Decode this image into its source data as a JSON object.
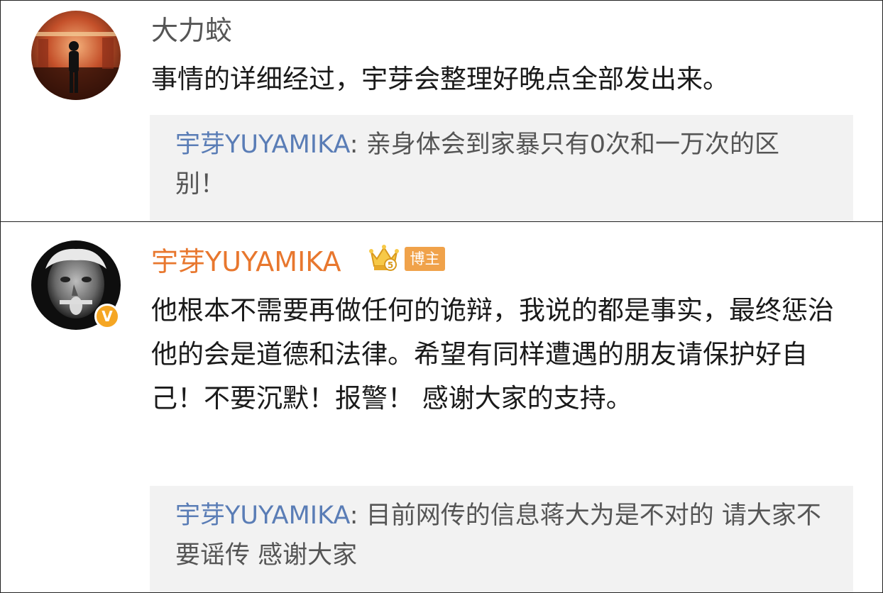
{
  "comments": [
    {
      "username": "大力蛟",
      "text": "事情的详细经过，宇芽会整理好晚点全部发出来。",
      "quote": {
        "author": "宇芽YUYAMIKA",
        "text": ": 亲身体会到家暴只有0次和一万次的区别！"
      },
      "avatar_icon": "user-avatar-photo"
    },
    {
      "username": "宇芽YUYAMIKA",
      "text": "他根本不需要再做任何的诡辩，我说的都是事实，最终惩治他的会是道德和法律。希望有同样遭遇的朋友请保护好自己！不要沉默！报警！ 感谢大家的支持。",
      "badges": {
        "verified": "V",
        "crown_level": "5",
        "author_tag": "博主"
      },
      "quote": {
        "author": "宇芽YUYAMIKA",
        "text": ": 目前网传的信息蒋大为是不对的 请大家不要谣传 感谢大家"
      },
      "avatar_icon": "user-avatar-photo"
    }
  ],
  "colors": {
    "author_name": "#e8772e",
    "quote_name": "#5a7db6",
    "username": "#555555",
    "quote_bg": "#f2f2f2",
    "verified_badge": "#f5a623",
    "author_tag": "#f0a24a"
  }
}
